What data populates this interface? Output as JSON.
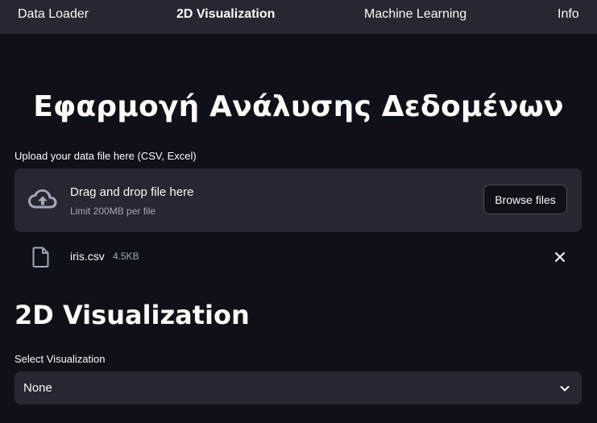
{
  "nav": {
    "items": [
      {
        "label": "Data Loader",
        "active": false
      },
      {
        "label": "2D Visualization",
        "active": true
      },
      {
        "label": "Machine Learning",
        "active": false
      },
      {
        "label": "Info",
        "active": false
      }
    ]
  },
  "main": {
    "title": "Εφαρμογή Ανάλυσης Δεδομένων",
    "uploader": {
      "label": "Upload your data file here (CSV, Excel)",
      "drop_text": "Drag and drop file here",
      "limit_text": "Limit 200MB per file",
      "browse_label": "Browse files",
      "upload_icon": "cloud-upload-icon"
    },
    "file": {
      "name": "iris.csv",
      "size": "4.5KB",
      "file_icon": "file-icon",
      "remove_icon": "close-icon"
    },
    "section_title": "2D Visualization",
    "select": {
      "label": "Select Visualization",
      "value": "None",
      "icon": "chevron-down-icon"
    }
  },
  "colors": {
    "background": "#0e1117",
    "navbar": "#262730",
    "panel": "#262730",
    "text": "#fafafa",
    "muted_text": "#a3a8b8"
  }
}
